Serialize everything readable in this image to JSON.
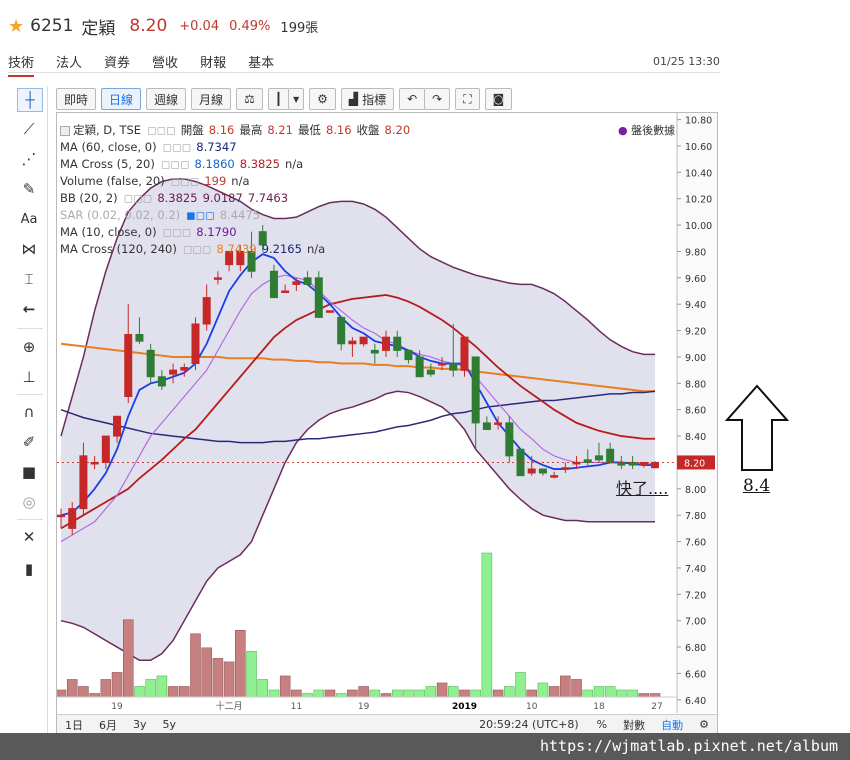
{
  "quote": {
    "code": "6251",
    "name": "定穎",
    "price": "8.20",
    "change": "+0.04",
    "pct": "0.49%",
    "volume": "199張"
  },
  "tabs": [
    "技術",
    "法人",
    "資券",
    "營收",
    "財報",
    "基本"
  ],
  "datetime": "01/25 13:30",
  "toolbar": {
    "period_buttons": [
      "即時",
      "日線",
      "週線",
      "月線"
    ],
    "indicator_label": "指標"
  },
  "legend": {
    "main": {
      "label": "定穎, D, TSE",
      "o_label": "開盤",
      "o": "8.16",
      "h_label": "最高",
      "h": "8.21",
      "l_label": "最低",
      "l": "8.16",
      "c_label": "收盤",
      "c": "8.20"
    },
    "ma60": {
      "label": "MA (60, close, 0)",
      "value": "8.7347"
    },
    "macross520": {
      "label": "MA Cross (5, 20)",
      "v1": "8.1860",
      "v2": "8.3825",
      "v3": "n/a"
    },
    "volume": {
      "label": "Volume (false, 20)",
      "v1": "199",
      "v2": "n/a"
    },
    "bb": {
      "label": "BB (20, 2)",
      "v1": "8.3825",
      "v2": "9.0187",
      "v3": "7.7463"
    },
    "sar": {
      "label": "SAR (0.02, 0.02, 0.2)",
      "value": "8.4475"
    },
    "ma10": {
      "label": "MA (10, close, 0)",
      "value": "8.1790"
    },
    "macross120": {
      "label": "MA Cross (120, 240)",
      "v1": "8.7439",
      "v2": "9.2165",
      "v3": "n/a"
    }
  },
  "after_hours": "盤後數據",
  "price_axis": [
    "10.80",
    "10.60",
    "10.40",
    "10.20",
    "10.00",
    "9.80",
    "9.60",
    "9.40",
    "9.20",
    "9.00",
    "8.80",
    "8.60",
    "8.40",
    "8.20",
    "8.00",
    "7.80",
    "7.60",
    "7.40",
    "7.20",
    "7.00",
    "6.80",
    "6.60",
    "6.40"
  ],
  "current_price_tag": "8.20",
  "x_axis": [
    "19",
    "十二月",
    "11",
    "19",
    "2019",
    "10",
    "18",
    "27"
  ],
  "bottom_bar": {
    "ranges": [
      "1日",
      "6月",
      "3y",
      "5y"
    ],
    "time": "20:59:24 (UTC+8)",
    "pct": "%",
    "log": "對數",
    "auto": "自動"
  },
  "annotation_text": "快了....",
  "side_annotation": "8.4",
  "watermark": "https://wjmatlab.pixnet.net/album",
  "chart_data": {
    "type": "candlestick",
    "ylim": [
      6.3,
      10.85
    ],
    "candles": [
      {
        "o": 7.8,
        "h": 7.85,
        "l": 7.7,
        "c": 7.8
      },
      {
        "o": 7.7,
        "h": 7.9,
        "l": 7.65,
        "c": 7.85
      },
      {
        "o": 7.85,
        "h": 8.35,
        "l": 7.8,
        "c": 8.25
      },
      {
        "o": 8.2,
        "h": 8.25,
        "l": 8.15,
        "c": 8.2
      },
      {
        "o": 8.2,
        "h": 8.4,
        "l": 8.15,
        "c": 8.4
      },
      {
        "o": 8.4,
        "h": 8.55,
        "l": 8.35,
        "c": 8.55
      },
      {
        "o": 8.7,
        "h": 9.4,
        "l": 8.65,
        "c": 9.17
      },
      {
        "o": 9.17,
        "h": 9.3,
        "l": 9.1,
        "c": 9.12
      },
      {
        "o": 9.05,
        "h": 9.1,
        "l": 8.8,
        "c": 8.85
      },
      {
        "o": 8.85,
        "h": 8.9,
        "l": 8.75,
        "c": 8.78
      },
      {
        "o": 8.87,
        "h": 8.95,
        "l": 8.8,
        "c": 8.9
      },
      {
        "o": 8.9,
        "h": 8.95,
        "l": 8.85,
        "c": 8.92
      },
      {
        "o": 8.95,
        "h": 9.3,
        "l": 8.9,
        "c": 9.25
      },
      {
        "o": 9.25,
        "h": 9.55,
        "l": 9.2,
        "c": 9.45
      },
      {
        "o": 9.6,
        "h": 9.65,
        "l": 9.55,
        "c": 9.6
      },
      {
        "o": 9.7,
        "h": 9.8,
        "l": 9.65,
        "c": 9.8
      },
      {
        "o": 9.7,
        "h": 9.85,
        "l": 9.65,
        "c": 9.8
      },
      {
        "o": 9.8,
        "h": 9.95,
        "l": 9.6,
        "c": 9.65
      },
      {
        "o": 9.95,
        "h": 10.0,
        "l": 9.8,
        "c": 9.85
      },
      {
        "o": 9.65,
        "h": 9.7,
        "l": 9.45,
        "c": 9.45
      },
      {
        "o": 9.5,
        "h": 9.55,
        "l": 9.5,
        "c": 9.5
      },
      {
        "o": 9.55,
        "h": 9.6,
        "l": 9.5,
        "c": 9.57
      },
      {
        "o": 9.6,
        "h": 9.65,
        "l": 9.55,
        "c": 9.55
      },
      {
        "o": 9.6,
        "h": 9.65,
        "l": 9.4,
        "c": 9.3
      },
      {
        "o": 9.35,
        "h": 9.35,
        "l": 9.35,
        "c": 9.35
      },
      {
        "o": 9.3,
        "h": 9.3,
        "l": 9.05,
        "c": 9.1
      },
      {
        "o": 9.1,
        "h": 9.15,
        "l": 9.0,
        "c": 9.12
      },
      {
        "o": 9.1,
        "h": 9.15,
        "l": 9.08,
        "c": 9.15
      },
      {
        "o": 9.05,
        "h": 9.1,
        "l": 8.95,
        "c": 9.03
      },
      {
        "o": 9.05,
        "h": 9.2,
        "l": 9.0,
        "c": 9.15
      },
      {
        "o": 9.15,
        "h": 9.2,
        "l": 9.0,
        "c": 9.05
      },
      {
        "o": 9.05,
        "h": 9.05,
        "l": 8.95,
        "c": 8.98
      },
      {
        "o": 9.0,
        "h": 9.05,
        "l": 8.85,
        "c": 8.85
      },
      {
        "o": 8.9,
        "h": 8.95,
        "l": 8.85,
        "c": 8.87
      },
      {
        "o": 8.95,
        "h": 9.0,
        "l": 8.9,
        "c": 8.95
      },
      {
        "o": 8.95,
        "h": 9.25,
        "l": 8.85,
        "c": 8.9
      },
      {
        "o": 8.9,
        "h": 9.1,
        "l": 8.85,
        "c": 9.15
      },
      {
        "o": 9.0,
        "h": 9.0,
        "l": 8.3,
        "c": 8.5
      },
      {
        "o": 8.5,
        "h": 8.55,
        "l": 8.45,
        "c": 8.45
      },
      {
        "o": 8.5,
        "h": 8.55,
        "l": 8.45,
        "c": 8.5
      },
      {
        "o": 8.5,
        "h": 8.55,
        "l": 8.2,
        "c": 8.25
      },
      {
        "o": 8.3,
        "h": 8.3,
        "l": 8.1,
        "c": 8.1
      },
      {
        "o": 8.12,
        "h": 8.25,
        "l": 8.1,
        "c": 8.15
      },
      {
        "o": 8.15,
        "h": 8.15,
        "l": 8.1,
        "c": 8.12
      },
      {
        "o": 8.1,
        "h": 8.13,
        "l": 8.08,
        "c": 8.1
      },
      {
        "o": 8.15,
        "h": 8.2,
        "l": 8.12,
        "c": 8.16
      },
      {
        "o": 8.2,
        "h": 8.25,
        "l": 8.15,
        "c": 8.2
      },
      {
        "o": 8.22,
        "h": 8.3,
        "l": 8.18,
        "c": 8.2
      },
      {
        "o": 8.25,
        "h": 8.35,
        "l": 8.2,
        "c": 8.22
      },
      {
        "o": 8.3,
        "h": 8.35,
        "l": 8.2,
        "c": 8.2
      },
      {
        "o": 8.2,
        "h": 8.25,
        "l": 8.15,
        "c": 8.18
      },
      {
        "o": 8.2,
        "h": 8.25,
        "l": 8.15,
        "c": 8.18
      },
      {
        "o": 8.18,
        "h": 8.2,
        "l": 8.16,
        "c": 8.2
      },
      {
        "o": 8.16,
        "h": 8.21,
        "l": 8.16,
        "c": 8.2
      }
    ],
    "volumes": [
      2,
      5,
      3,
      1,
      5,
      7,
      22,
      3,
      5,
      6,
      3,
      3,
      18,
      14,
      11,
      10,
      19,
      13,
      5,
      2,
      6,
      2,
      1,
      2,
      2,
      1,
      2,
      3,
      2,
      1,
      2,
      2,
      2,
      3,
      4,
      3,
      2,
      2,
      41,
      2,
      3,
      7,
      2,
      4,
      3,
      6,
      5,
      2,
      3,
      3,
      2,
      2,
      1,
      1
    ],
    "ma_blue": [
      7.8,
      7.82,
      7.9,
      8.0,
      8.12,
      8.3,
      8.55,
      8.75,
      8.8,
      8.82,
      8.85,
      8.88,
      8.95,
      9.1,
      9.3,
      9.5,
      9.62,
      9.72,
      9.78,
      9.75,
      9.65,
      9.58,
      9.55,
      9.48,
      9.4,
      9.3,
      9.22,
      9.18,
      9.12,
      9.1,
      9.08,
      9.05,
      9.0,
      8.97,
      8.95,
      8.95,
      8.95,
      8.8,
      8.65,
      8.5,
      8.4,
      8.3,
      8.22,
      8.18,
      8.15,
      8.15,
      8.16,
      8.17,
      8.18,
      8.2,
      8.2,
      8.19,
      8.18,
      8.18
    ],
    "ma_violet": [
      7.6,
      7.65,
      7.7,
      7.75,
      7.85,
      7.95,
      8.1,
      8.25,
      8.4,
      8.5,
      8.6,
      8.7,
      8.8,
      8.9,
      9.05,
      9.2,
      9.35,
      9.48,
      9.55,
      9.6,
      9.62,
      9.6,
      9.58,
      9.5,
      9.42,
      9.35,
      9.28,
      9.22,
      9.18,
      9.12,
      9.1,
      9.05,
      9.02,
      9.0,
      8.97,
      8.95,
      8.93,
      8.85,
      8.75,
      8.65,
      8.55,
      8.45,
      8.38,
      8.3,
      8.25,
      8.22,
      8.2,
      8.2,
      8.2,
      8.2,
      8.2,
      8.2,
      8.19,
      8.19
    ],
    "ma_red": [
      7.7,
      7.75,
      7.8,
      7.85,
      7.9,
      7.95,
      8.0,
      8.08,
      8.15,
      8.22,
      8.3,
      8.38,
      8.45,
      8.55,
      8.65,
      8.75,
      8.85,
      8.95,
      9.05,
      9.15,
      9.22,
      9.28,
      9.32,
      9.36,
      9.4,
      9.42,
      9.44,
      9.45,
      9.46,
      9.47,
      9.45,
      9.42,
      9.38,
      9.33,
      9.28,
      9.22,
      9.15,
      9.08,
      9.0,
      8.92,
      8.85,
      8.78,
      8.72,
      8.66,
      8.6,
      8.55,
      8.5,
      8.47,
      8.44,
      8.42,
      8.4,
      8.39,
      8.38,
      8.38
    ],
    "ma_orange": [
      9.1,
      9.09,
      9.08,
      9.07,
      9.06,
      9.05,
      9.04,
      9.03,
      9.02,
      9.01,
      9.0,
      9.0,
      9.0,
      9.0,
      9.0,
      8.99,
      8.99,
      8.99,
      8.99,
      8.98,
      8.98,
      8.97,
      8.97,
      8.96,
      8.96,
      8.95,
      8.95,
      8.95,
      8.94,
      8.94,
      8.93,
      8.93,
      8.92,
      8.92,
      8.91,
      8.91,
      8.9,
      8.89,
      8.88,
      8.87,
      8.86,
      8.85,
      8.84,
      8.83,
      8.82,
      8.81,
      8.8,
      8.79,
      8.78,
      8.77,
      8.76,
      8.75,
      8.74,
      8.74
    ],
    "ma_navy": [
      8.6,
      8.57,
      8.54,
      8.52,
      8.5,
      8.48,
      8.46,
      8.44,
      8.42,
      8.41,
      8.4,
      8.39,
      8.38,
      8.37,
      8.36,
      8.36,
      8.35,
      8.35,
      8.35,
      8.36,
      8.36,
      8.37,
      8.38,
      8.38,
      8.39,
      8.4,
      8.41,
      8.42,
      8.43,
      8.45,
      8.47,
      8.48,
      8.5,
      8.52,
      8.55,
      8.57,
      8.58,
      8.6,
      8.62,
      8.63,
      8.64,
      8.65,
      8.66,
      8.67,
      8.67,
      8.68,
      8.69,
      8.7,
      8.71,
      8.72,
      8.72,
      8.73,
      8.73,
      8.74
    ],
    "bb_upper": [
      8.4,
      8.7,
      9.0,
      9.35,
      9.65,
      9.9,
      10.1,
      10.2,
      10.28,
      10.33,
      10.35,
      10.35,
      10.33,
      10.3,
      10.26,
      10.22,
      10.18,
      10.12,
      10.08,
      10.05,
      10.05,
      10.06,
      10.1,
      10.14,
      10.17,
      10.18,
      10.18,
      10.16,
      10.12,
      10.06,
      9.98,
      9.9,
      9.82,
      9.76,
      9.72,
      9.68,
      9.65,
      9.62,
      9.6,
      9.58,
      9.56,
      9.55,
      9.55,
      9.52,
      9.48,
      9.42,
      9.35,
      9.28,
      9.2,
      9.13,
      9.08,
      9.04,
      9.02,
      9.02
    ],
    "bb_lower": [
      7.0,
      6.98,
      6.95,
      6.9,
      6.85,
      6.8,
      6.75,
      6.7,
      6.7,
      6.75,
      6.85,
      7.0,
      7.15,
      7.3,
      7.4,
      7.45,
      7.5,
      7.6,
      7.8,
      8.0,
      8.2,
      8.35,
      8.45,
      8.52,
      8.57,
      8.6,
      8.62,
      8.65,
      8.68,
      8.72,
      8.74,
      8.73,
      8.7,
      8.66,
      8.62,
      8.55,
      8.45,
      8.3,
      8.2,
      8.1,
      8.0,
      7.92,
      7.85,
      7.8,
      7.78,
      7.76,
      7.76,
      7.75,
      7.75,
      7.75,
      7.75,
      7.75,
      7.75,
      7.75
    ]
  }
}
